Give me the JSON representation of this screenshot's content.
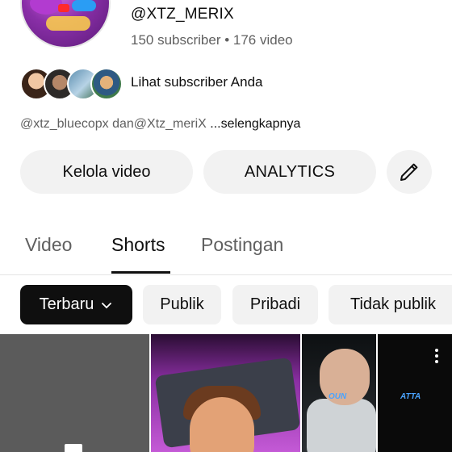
{
  "channel": {
    "handle": "@XTZ_MERIX",
    "stats": "150 subscriber • 176 video",
    "subscribers_link": "Lihat subscriber Anda",
    "description_prefix": "@xtz_bluecopx dan@Xtz_meriX ",
    "description_more": "...selengkapnya"
  },
  "actions": {
    "manage_videos": "Kelola video",
    "analytics": "ANALYTICS",
    "edit_icon": "pencil-icon"
  },
  "tabs": [
    {
      "label": "Video",
      "active": false
    },
    {
      "label": "Shorts",
      "active": true
    },
    {
      "label": "Postingan",
      "active": false
    }
  ],
  "filters": {
    "latest": "Terbaru",
    "latest_icon": "chevron-down-icon",
    "public": "Publik",
    "private": "Pribadi",
    "unlisted": "Tidak publik"
  },
  "thumbnails": {
    "t3_label": "OUN",
    "t4_label": "ATTA"
  }
}
